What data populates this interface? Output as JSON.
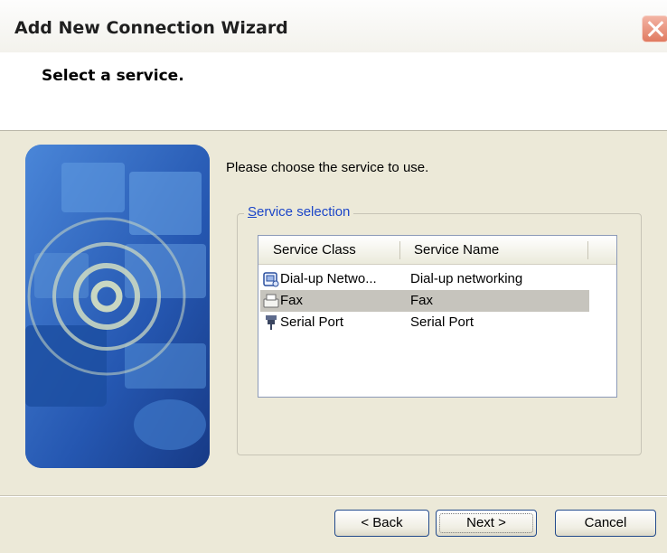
{
  "window": {
    "title": "Add New Connection Wizard"
  },
  "header": {
    "title": "Select a service."
  },
  "content": {
    "instruction": "Please choose the service to use.",
    "group_label": "Service selection",
    "list": {
      "columns": [
        "Service Class",
        "Service Name"
      ],
      "rows": [
        {
          "class": "Dial-up Netwo...",
          "name": "Dial-up networking",
          "icon": "dialup-icon",
          "selected": false
        },
        {
          "class": "Fax",
          "name": "Fax",
          "icon": "fax-icon",
          "selected": true
        },
        {
          "class": "Serial Port",
          "name": "Serial Port",
          "icon": "serial-port-icon",
          "selected": false
        }
      ]
    }
  },
  "buttons": {
    "back": "< Back",
    "next": "Next >",
    "cancel": "Cancel"
  },
  "colors": {
    "group_label": "#1c46c8",
    "selection": "#c6c4bd",
    "banner": "#2457b0"
  }
}
